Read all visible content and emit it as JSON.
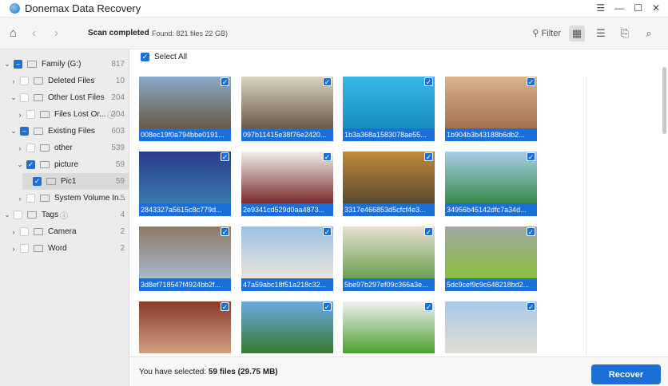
{
  "app": {
    "title": "Donemax Data Recovery"
  },
  "toolbar": {
    "status": "Scan completed",
    "found": "Found: 821 files 22 GB)",
    "filter": "Filter"
  },
  "tree": [
    {
      "label": "Family (G:)",
      "count": "817",
      "level": 0,
      "state": "partial",
      "expanded": true,
      "icon": "drive-icon"
    },
    {
      "label": "Deleted Files",
      "count": "10",
      "level": 1,
      "state": "off",
      "expanded": false
    },
    {
      "label": "Other Lost Files",
      "count": "204",
      "level": 1,
      "state": "off",
      "expanded": true
    },
    {
      "label": "Files Lost Or...",
      "count": "204",
      "level": 2,
      "state": "off",
      "expanded": false,
      "help": true
    },
    {
      "label": "Existing Files",
      "count": "603",
      "level": 1,
      "state": "partial",
      "expanded": true
    },
    {
      "label": "other",
      "count": "539",
      "level": 2,
      "state": "off",
      "expanded": false
    },
    {
      "label": "picture",
      "count": "59",
      "level": 2,
      "state": "on",
      "expanded": true
    },
    {
      "label": "Pic1",
      "count": "59",
      "level": 3,
      "state": "on",
      "selected": true
    },
    {
      "label": "System Volume In...",
      "count": "5",
      "level": 2,
      "state": "off",
      "expanded": false
    },
    {
      "label": "Tags",
      "count": "4",
      "level": 0,
      "state": "off",
      "expanded": true,
      "help": true
    },
    {
      "label": "Camera",
      "count": "2",
      "level": 1,
      "state": "off",
      "expanded": false
    },
    {
      "label": "Word",
      "count": "2",
      "level": 1,
      "state": "off",
      "expanded": false
    }
  ],
  "select_all": "Select All",
  "files": [
    {
      "name": "008ec19f0a794bbe0191...",
      "colors": [
        "#8aa9c8",
        "#6a5a48"
      ]
    },
    {
      "name": "097b11415e38f76e2420...",
      "colors": [
        "#d9d2c0",
        "#6d5a4a"
      ]
    },
    {
      "name": "1b3a368a1583078ae55...",
      "colors": [
        "#35b5e6",
        "#1a8fc0"
      ]
    },
    {
      "name": "1b904b3b43188b6db2...",
      "colors": [
        "#d9b48c",
        "#a07050"
      ]
    },
    {
      "name": "2843327a5615c8c779d...",
      "colors": [
        "#2a3c8a",
        "#3a7ab0"
      ]
    },
    {
      "name": "2e9341cd529d0aa4873...",
      "colors": [
        "#f2efe9",
        "#7a2a2a"
      ]
    },
    {
      "name": "3317e466853d5cfcf4e3...",
      "colors": [
        "#c08a3a",
        "#5a4a30"
      ]
    },
    {
      "name": "34956b45142dfc7a34d...",
      "colors": [
        "#a8cde8",
        "#3a8a4a"
      ]
    },
    {
      "name": "3d8ef718547f4924bb2f...",
      "colors": [
        "#8a7a68",
        "#a8b8c8"
      ]
    },
    {
      "name": "47a59abc18f51a218c32...",
      "colors": [
        "#9ec0e0",
        "#e8e4dc"
      ]
    },
    {
      "name": "5be97b297ef09c366a3e...",
      "colors": [
        "#e8e0d0",
        "#6aa050"
      ]
    },
    {
      "name": "5dc9cef9c9c648218bd2...",
      "colors": [
        "#a0a8a0",
        "#8ac040"
      ]
    },
    {
      "name": "",
      "colors": [
        "#8a3a2a",
        "#d0a080"
      ]
    },
    {
      "name": "",
      "colors": [
        "#6aa8e0",
        "#3a7a30"
      ]
    },
    {
      "name": "",
      "colors": [
        "#f0f0f0",
        "#4aa030"
      ]
    },
    {
      "name": "",
      "colors": [
        "#a8c8e8",
        "#e0dcd4"
      ]
    }
  ],
  "footer": {
    "prefix": "You have selected: ",
    "selected": "59 files (29.75 MB)",
    "recover": "Recover"
  },
  "colors": {
    "accent": "#1a6fd8"
  }
}
